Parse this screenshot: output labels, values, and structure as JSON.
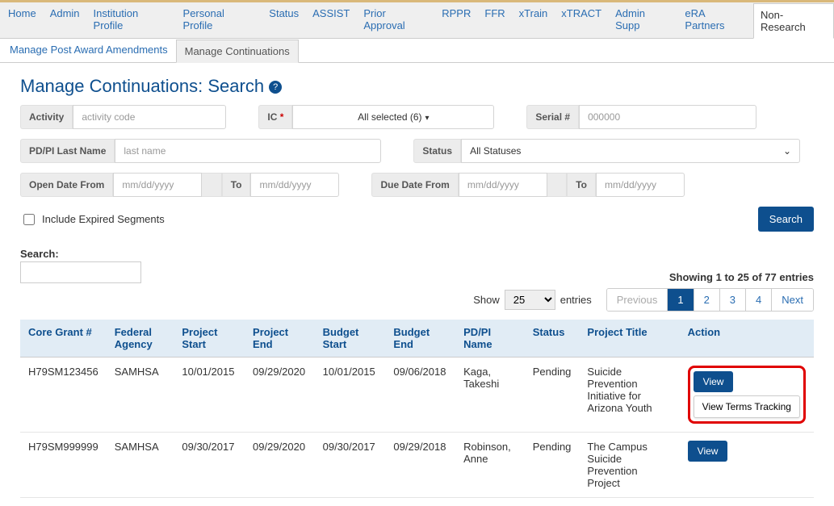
{
  "top_tabs": [
    "Home",
    "Admin",
    "Institution Profile",
    "Personal Profile",
    "Status",
    "ASSIST",
    "Prior Approval",
    "RPPR",
    "FFR",
    "xTrain",
    "xTRACT",
    "Admin Supp",
    "eRA Partners",
    "Non-Research"
  ],
  "top_tabs_active": 13,
  "sub_tabs": [
    "Manage Post Award Amendments",
    "Manage Continuations"
  ],
  "sub_tabs_active": 1,
  "page_title": "Manage Continuations: Search",
  "labels": {
    "activity": "Activity",
    "ic": "IC",
    "serial": "Serial #",
    "pdpi": "PD/PI Last Name",
    "status": "Status",
    "open_from": "Open Date From",
    "to": "To",
    "due_from": "Due Date From",
    "include_expired": "Include Expired Segments",
    "search_btn": "Search",
    "search_local": "Search:",
    "show": "Show",
    "entries": "entries"
  },
  "placeholders": {
    "activity": "activity code",
    "serial": "000000",
    "lastname": "last name",
    "date": "mm/dd/yyyy"
  },
  "ic_value": "All selected (6)",
  "status_value": "All Statuses",
  "results_summary": "Showing 1 to 25 of 77 entries",
  "page_size": "25",
  "pagination": {
    "prev": "Previous",
    "pages": [
      "1",
      "2",
      "3",
      "4"
    ],
    "active": 0,
    "next": "Next"
  },
  "columns": [
    "Core Grant #",
    "Federal Agency",
    "Project Start",
    "Project End",
    "Budget Start",
    "Budget End",
    "PD/PI Name",
    "Status",
    "Project Title",
    "Action"
  ],
  "rows": [
    {
      "grant": "H79SM123456",
      "agency": "SAMHSA",
      "pstart": "10/01/2015",
      "pend": "09/29/2020",
      "bstart": "10/01/2015",
      "bend": "09/06/2018",
      "pdpi": "Kaga, Takeshi",
      "status": "Pending",
      "title": "Suicide Prevention Initiative for Arizona Youth",
      "actions": [
        "View",
        "View Terms Tracking"
      ],
      "highlight": true
    },
    {
      "grant": "H79SM999999",
      "agency": "SAMHSA",
      "pstart": "09/30/2017",
      "pend": "09/29/2020",
      "bstart": "09/30/2017",
      "bend": "09/29/2018",
      "pdpi": "Robinson, Anne",
      "status": "Pending",
      "title": "The Campus Suicide Prevention Project",
      "actions": [
        "View"
      ],
      "highlight": false
    }
  ]
}
